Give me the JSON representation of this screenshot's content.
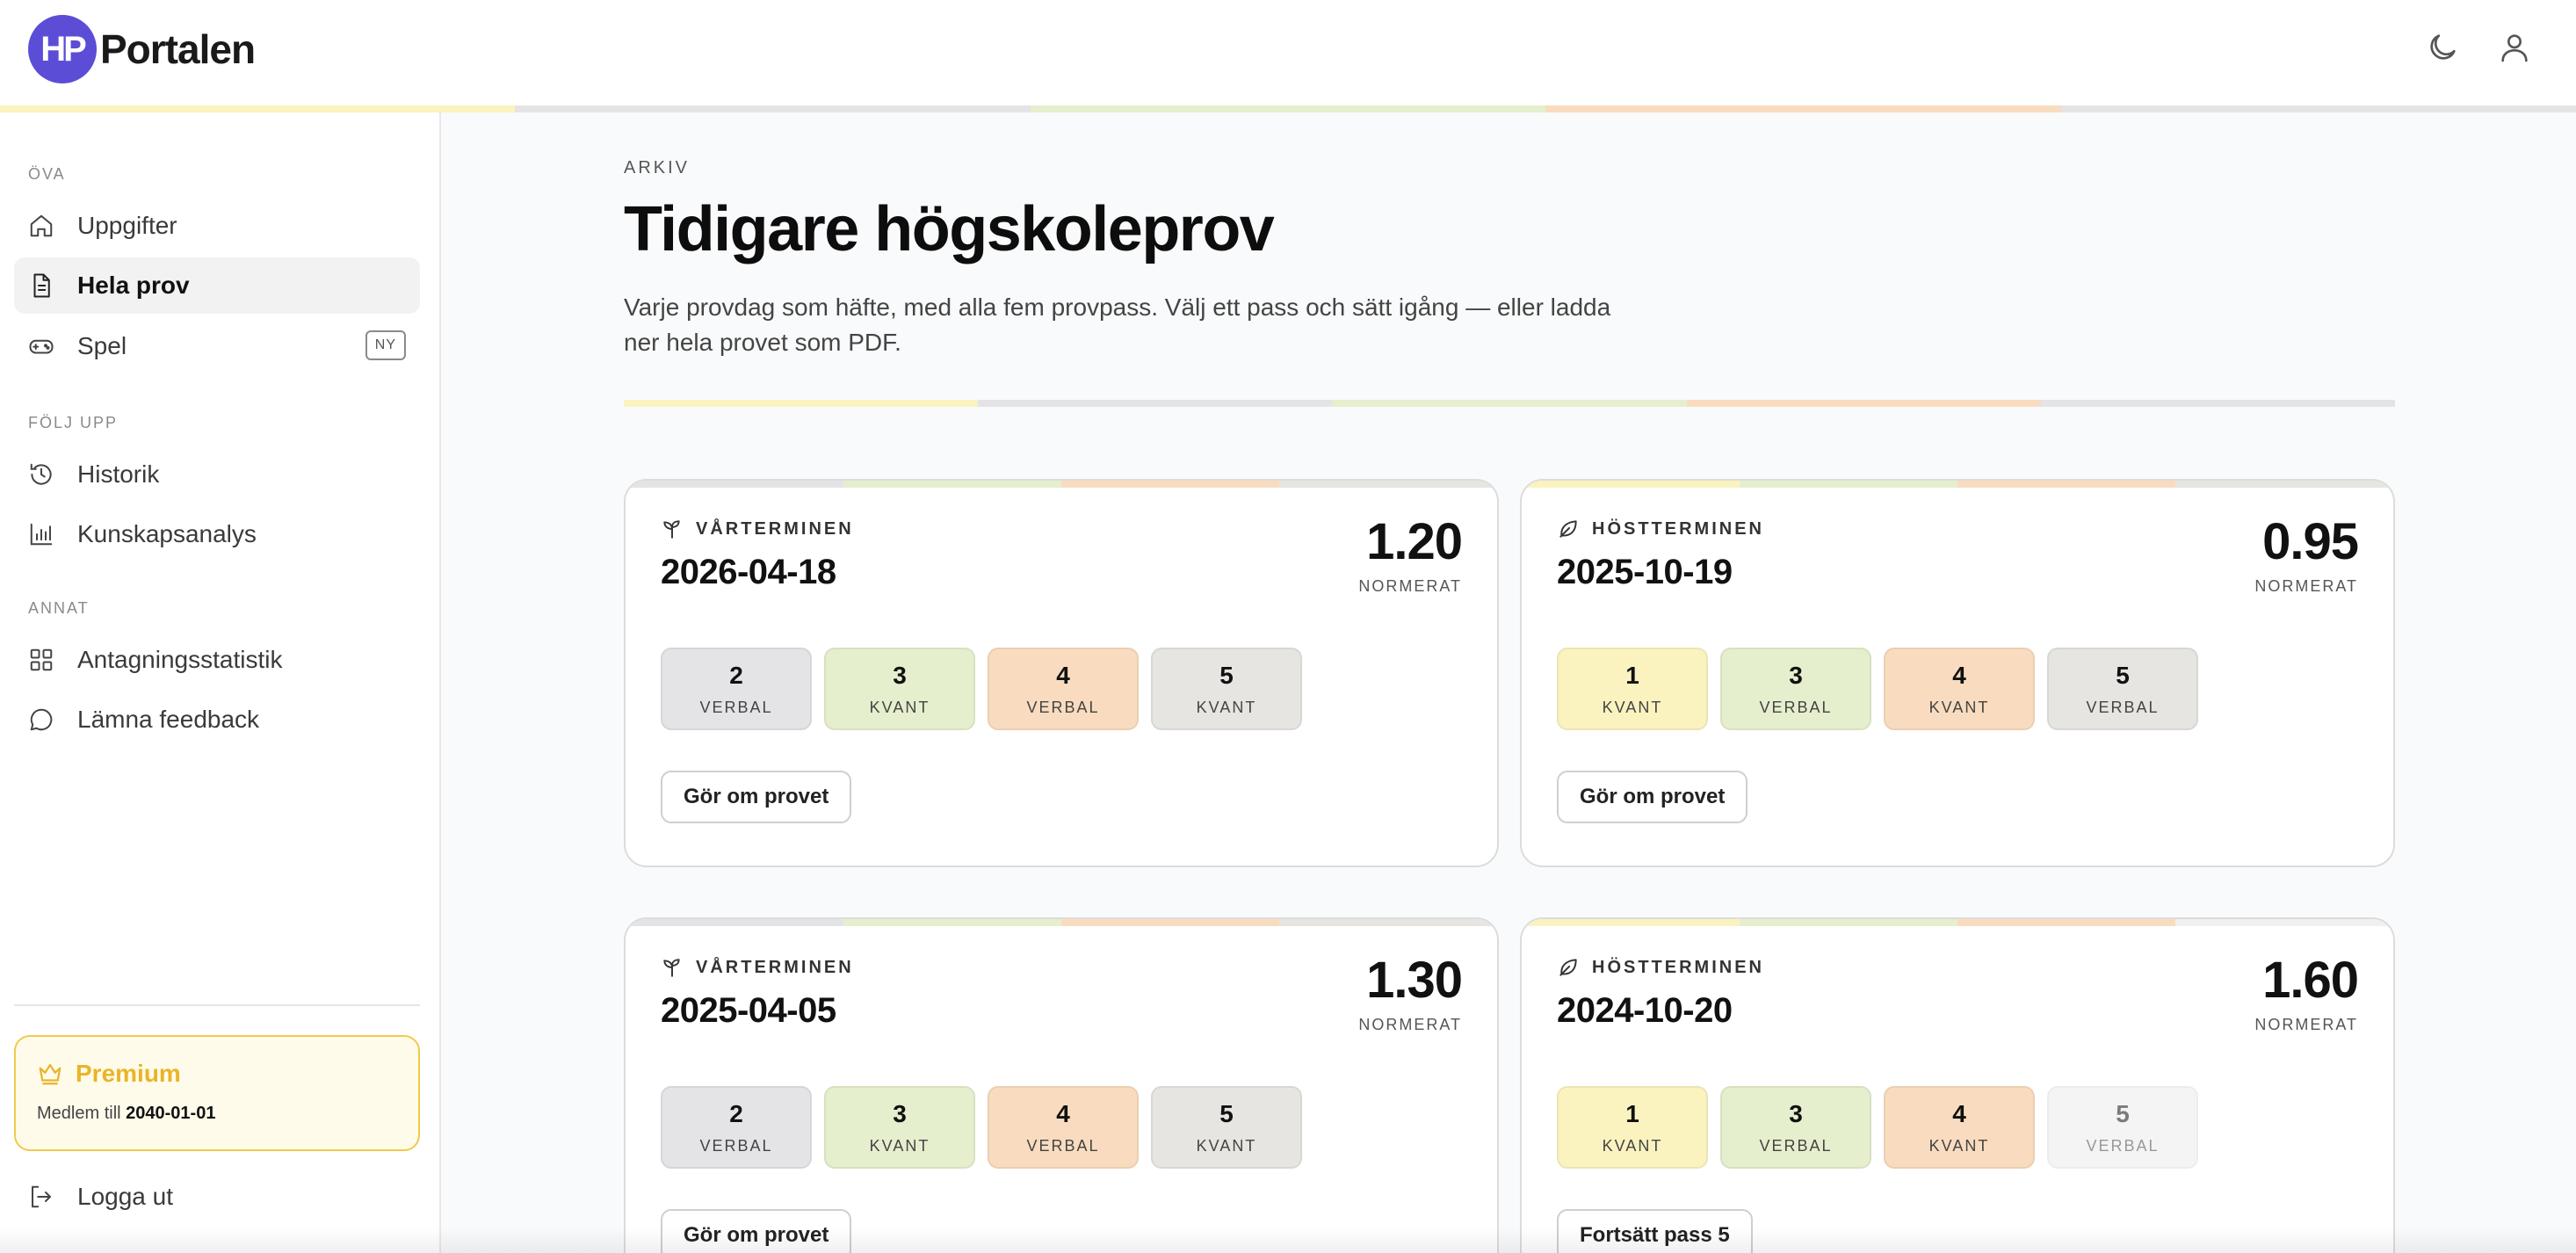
{
  "brand": {
    "badge": "HP",
    "name": "Portalen"
  },
  "colors": {
    "yellow": "#fbf3bf",
    "green": "#e6efcd",
    "orange": "#f9dcbf",
    "gray": "#e4e4e7",
    "stone": "#e6e5e1",
    "accent": "#5b4dd6",
    "premium": "#e8b52a"
  },
  "topbar": {
    "icons": [
      "moon-icon",
      "user-icon"
    ]
  },
  "sidebar": {
    "sections": [
      {
        "label": "ÖVA",
        "items": [
          {
            "label": "Uppgifter",
            "icon": "home-icon"
          },
          {
            "label": "Hela prov",
            "icon": "document-icon",
            "active": true
          },
          {
            "label": "Spel",
            "icon": "gamepad-icon",
            "badge": "NY"
          }
        ]
      },
      {
        "label": "FÖLJ UPP",
        "items": [
          {
            "label": "Historik",
            "icon": "history-icon"
          },
          {
            "label": "Kunskapsanalys",
            "icon": "bar-chart-icon"
          }
        ]
      },
      {
        "label": "ANNAT",
        "items": [
          {
            "label": "Antagningsstatistik",
            "icon": "grid-icon"
          },
          {
            "label": "Lämna feedback",
            "icon": "chat-bubble-icon"
          }
        ]
      }
    ],
    "premium": {
      "title": "Premium",
      "member_prefix": "Medlem till",
      "member_date": "2040-01-01"
    },
    "logout": "Logga ut"
  },
  "main": {
    "eyebrow": "ARKIV",
    "title": "Tidigare högskoleprov",
    "description": "Varje provdag som häfte, med alla fem provpass. Välj ett pass och sätt igång — eller ladda ner hela provet som PDF.",
    "score_label": "NORMERAT",
    "cards": [
      {
        "term": "VÅRTERMINEN",
        "term_icon": "sprout-icon",
        "date": "2026-04-18",
        "score": "1.20",
        "passes": [
          {
            "num": "2",
            "type": "VERBAL"
          },
          {
            "num": "3",
            "type": "KVANT"
          },
          {
            "num": "4",
            "type": "VERBAL"
          },
          {
            "num": "5",
            "type": "KVANT"
          }
        ],
        "button": "Gör om provet"
      },
      {
        "term": "HÖSTTERMINEN",
        "term_icon": "leaf-icon",
        "date": "2025-10-19",
        "score": "0.95",
        "passes": [
          {
            "num": "1",
            "type": "KVANT"
          },
          {
            "num": "3",
            "type": "VERBAL"
          },
          {
            "num": "4",
            "type": "KVANT"
          },
          {
            "num": "5",
            "type": "VERBAL"
          }
        ],
        "button": "Gör om provet"
      },
      {
        "term": "VÅRTERMINEN",
        "term_icon": "sprout-icon",
        "date": "2025-04-05",
        "score": "1.30",
        "passes": [
          {
            "num": "2",
            "type": "VERBAL"
          },
          {
            "num": "3",
            "type": "KVANT"
          },
          {
            "num": "4",
            "type": "VERBAL"
          },
          {
            "num": "5",
            "type": "KVANT"
          }
        ],
        "button": "Gör om provet"
      },
      {
        "term": "HÖSTTERMINEN",
        "term_icon": "leaf-icon",
        "date": "2024-10-20",
        "score": "1.60",
        "passes": [
          {
            "num": "1",
            "type": "KVANT"
          },
          {
            "num": "3",
            "type": "VERBAL"
          },
          {
            "num": "4",
            "type": "KVANT"
          },
          {
            "num": "5",
            "type": "VERBAL",
            "incomplete": true
          }
        ],
        "button": "Fortsätt pass 5"
      }
    ]
  }
}
